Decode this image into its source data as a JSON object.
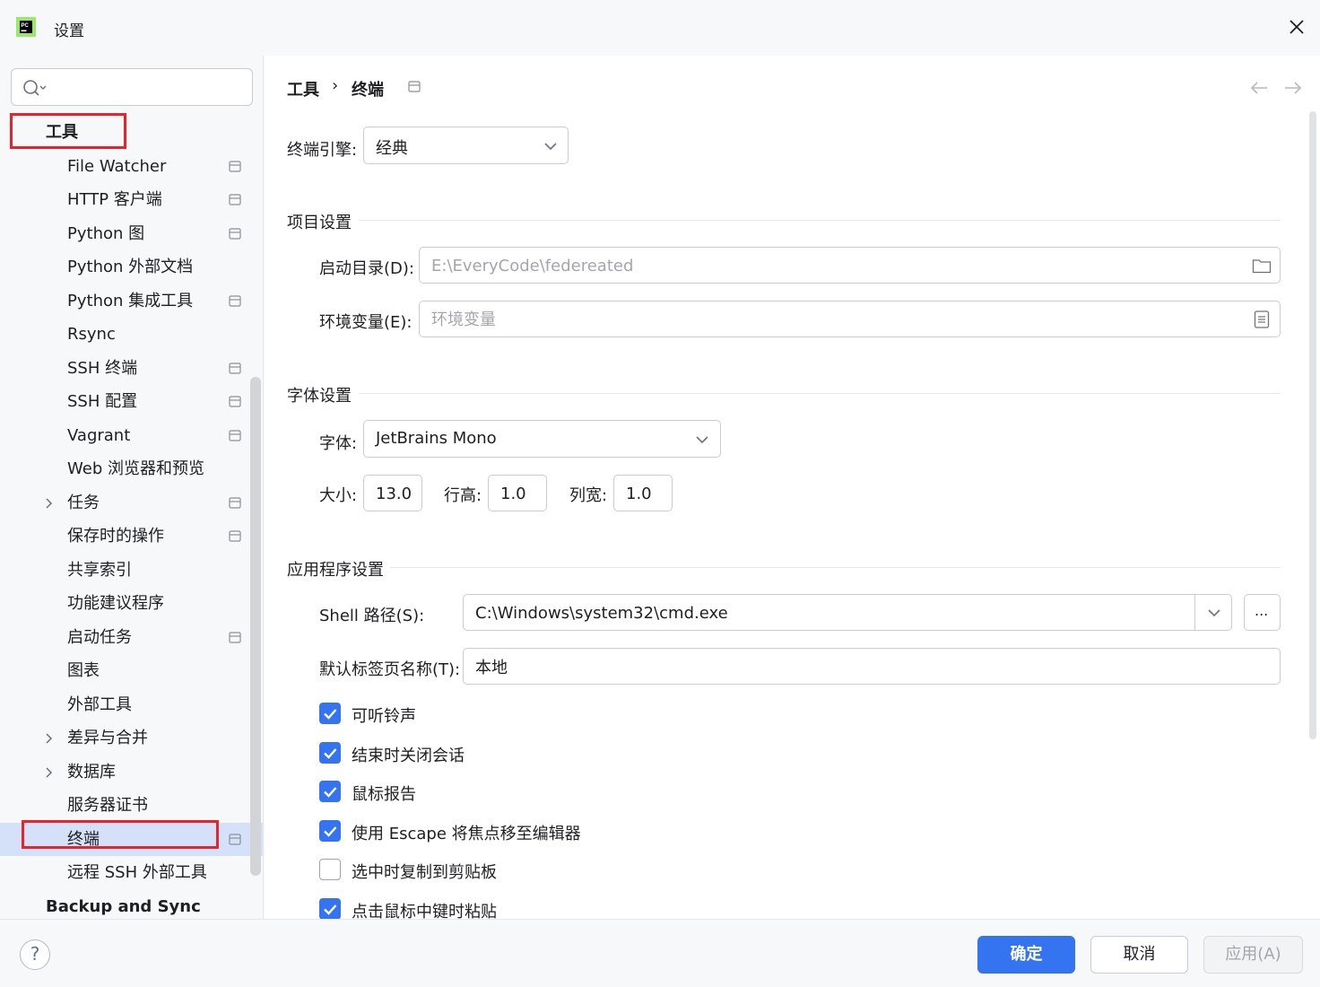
{
  "window": {
    "title": "设置",
    "close_icon": "close-icon"
  },
  "sidebar": {
    "search_placeholder": "",
    "items": [
      {
        "label": "工具",
        "level": 0,
        "badge": false,
        "chevron": false
      },
      {
        "label": "File Watcher",
        "level": 1,
        "badge": true,
        "chevron": false
      },
      {
        "label": "HTTP 客户端",
        "level": 1,
        "badge": true,
        "chevron": false
      },
      {
        "label": "Python 图",
        "level": 1,
        "badge": true,
        "chevron": false
      },
      {
        "label": "Python 外部文档",
        "level": 1,
        "badge": false,
        "chevron": false
      },
      {
        "label": "Python 集成工具",
        "level": 1,
        "badge": true,
        "chevron": false
      },
      {
        "label": "Rsync",
        "level": 1,
        "badge": false,
        "chevron": false
      },
      {
        "label": "SSH 终端",
        "level": 1,
        "badge": true,
        "chevron": false
      },
      {
        "label": "SSH 配置",
        "level": 1,
        "badge": true,
        "chevron": false
      },
      {
        "label": "Vagrant",
        "level": 1,
        "badge": true,
        "chevron": false
      },
      {
        "label": "Web 浏览器和预览",
        "level": 1,
        "badge": false,
        "chevron": false
      },
      {
        "label": "任务",
        "level": 1,
        "badge": true,
        "chevron": true
      },
      {
        "label": "保存时的操作",
        "level": 1,
        "badge": true,
        "chevron": false
      },
      {
        "label": "共享索引",
        "level": 1,
        "badge": false,
        "chevron": false
      },
      {
        "label": "功能建议程序",
        "level": 1,
        "badge": false,
        "chevron": false
      },
      {
        "label": "启动任务",
        "level": 1,
        "badge": true,
        "chevron": false
      },
      {
        "label": "图表",
        "level": 1,
        "badge": false,
        "chevron": false
      },
      {
        "label": "外部工具",
        "level": 1,
        "badge": false,
        "chevron": false
      },
      {
        "label": "差异与合并",
        "level": 1,
        "badge": false,
        "chevron": true
      },
      {
        "label": "数据库",
        "level": 1,
        "badge": false,
        "chevron": true
      },
      {
        "label": "服务器证书",
        "level": 1,
        "badge": false,
        "chevron": false
      },
      {
        "label": "终端",
        "level": 1,
        "badge": true,
        "chevron": false,
        "selected": true
      },
      {
        "label": "远程 SSH 外部工具",
        "level": 1,
        "badge": false,
        "chevron": false
      },
      {
        "label": "Backup and Sync",
        "level": 0,
        "badge": false,
        "chevron": false
      }
    ]
  },
  "breadcrumb": {
    "parent": "工具",
    "separator": "›",
    "current": "终端"
  },
  "terminal_engine": {
    "label": "终端引擎:",
    "value": "经典"
  },
  "project_settings": {
    "section": "项目设置",
    "start_dir_label": "启动目录(D):",
    "start_dir_value": "E:\\EveryCode\\federeated",
    "env_label": "环境变量(E):",
    "env_placeholder": "环境变量"
  },
  "font_settings": {
    "section": "字体设置",
    "font_label": "字体:",
    "font_value": "JetBrains Mono",
    "size_label": "大小:",
    "size_value": "13.0",
    "line_height_label": "行高:",
    "line_height_value": "1.0",
    "col_width_label": "列宽:",
    "col_width_value": "1.0"
  },
  "app_settings": {
    "section": "应用程序设置",
    "shell_label": "Shell 路径(S):",
    "shell_value": "C:\\Windows\\system32\\cmd.exe",
    "browse_label": "...",
    "tab_name_label": "默认标签页名称(T):",
    "tab_name_value": "本地",
    "checkboxes": [
      {
        "label": "可听铃声",
        "checked": true
      },
      {
        "label": "结束时关闭会话",
        "checked": true
      },
      {
        "label": "鼠标报告",
        "checked": true
      },
      {
        "label": "使用 Escape 将焦点移至编辑器",
        "checked": true
      },
      {
        "label": "选中时复制到剪贴板",
        "checked": false
      },
      {
        "label": "点击鼠标中键时粘贴",
        "checked": true
      }
    ]
  },
  "footer": {
    "help": "?",
    "ok": "确定",
    "cancel": "取消",
    "apply": "应用(A)"
  },
  "colors": {
    "accent": "#3574f0",
    "highlight": "#e8232b",
    "selected_bg": "#d5e1f8"
  }
}
